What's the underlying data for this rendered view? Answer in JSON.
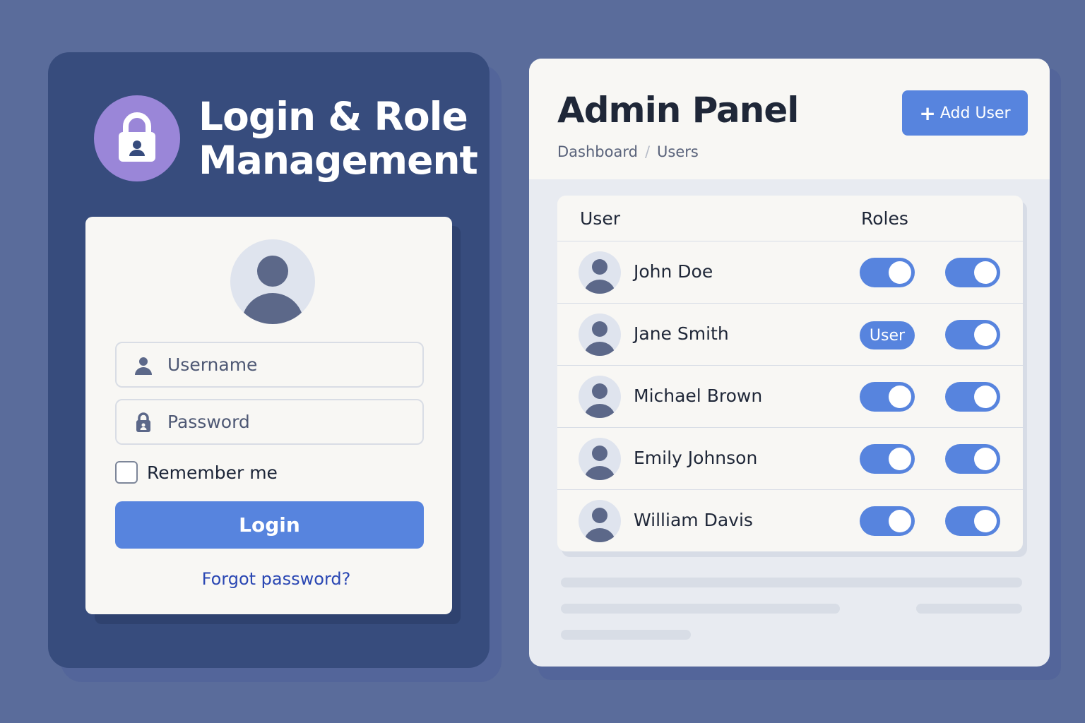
{
  "login_panel": {
    "title_line1": "Login & Role",
    "title_line2": "Management",
    "icon": "lock-icon",
    "username_placeholder": "Username",
    "password_placeholder": "Password",
    "remember_label": "Remember me",
    "login_label": "Login",
    "forgot_label": "Forgot password?"
  },
  "admin_panel": {
    "title": "Admin Panel",
    "add_user_label": "Add User",
    "breadcrumb": [
      "Dashboard",
      "Users"
    ],
    "columns": {
      "user": "User",
      "roles": "Roles"
    },
    "users": [
      {
        "name": "John Doe",
        "role_a": "on",
        "role_b": "on"
      },
      {
        "name": "Jane Smith",
        "role_a_label": "User",
        "role_b": "on"
      },
      {
        "name": "Michael Brown",
        "role_a": "on",
        "role_b": "on"
      },
      {
        "name": "Emily Johnson",
        "role_a": "on",
        "role_b": "on"
      },
      {
        "name": "William Davis",
        "role_a": "on",
        "role_b": "on"
      }
    ]
  },
  "colors": {
    "background": "#5a6c9b",
    "login_card": "#374c7d",
    "accent": "#5784de",
    "lock_badge": "#9a86d8",
    "link": "#2a47b3"
  }
}
